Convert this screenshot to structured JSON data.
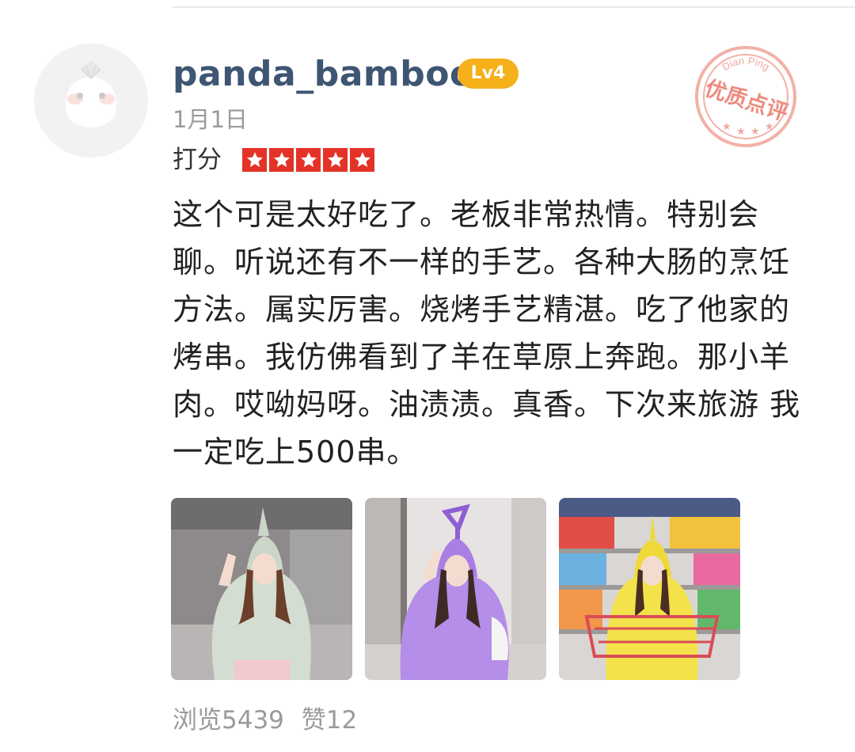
{
  "review": {
    "username": "panda_bamboo",
    "level": "Lv4",
    "date": "1月1日",
    "rating_label": "打分",
    "rating_stars": 5,
    "text": "这个可是太好吃了。老板非常热情。特别会聊。听说还有不一样的手艺。各种大肠的烹饪方法。属实厉害。烧烤手艺精湛。吃了他家的烤串。我仿佛看到了羊在草原上奔跑。那小羊肉。哎呦妈呀。油渍渍。真香。下次来旅游 我一定吃上500串。",
    "stamp": {
      "top_text": "Dian Ping",
      "main_text": "优质点评"
    },
    "photos": [
      {
        "icon": "photo-girl-green-hoodie",
        "accent": "#cbd6c8"
      },
      {
        "icon": "photo-girl-purple-hoodie",
        "accent": "#b48ee8"
      },
      {
        "icon": "photo-girl-yellow-hoodie",
        "accent": "#f3e24a"
      }
    ],
    "stats": {
      "views": "浏览5439",
      "likes": "赞12"
    }
  },
  "colors": {
    "username": "#3e5573",
    "badge": "#f5b01a",
    "star": "#e53227",
    "muted": "#9a9a9a",
    "stamp": "#f0a9a0"
  }
}
